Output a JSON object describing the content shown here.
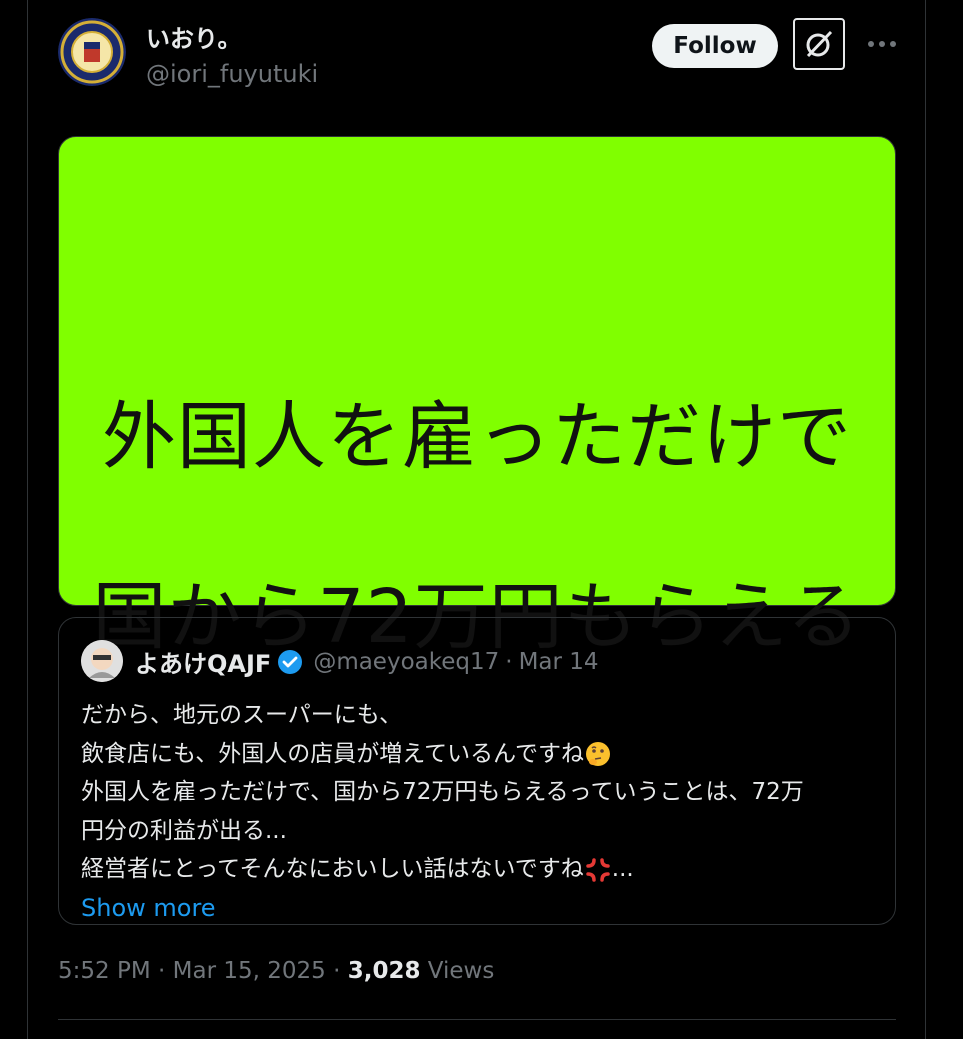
{
  "tweet": {
    "author": {
      "display_name": "いおり。",
      "handle": "@iori_fuyutuki"
    },
    "follow_label": "Follow",
    "image_text": {
      "line1": "外国人を雇っただけで",
      "line2": "国から72万円もらえる"
    },
    "quote": {
      "display_name": "よあけQAJF",
      "handle": "@maeyoakeq17",
      "separator": "·",
      "date": "Mar 14",
      "lines": [
        "だから、地元のスーパーにも、",
        "飲食店にも、外国人の店員が増えているんですね",
        "外国人を雇っただけで、国から72万円もらえるっていうことは、72万",
        "円分の利益が出る...",
        "経営者にとってそんなにおいしい話はないですね"
      ],
      "trailing_ellipsis": "...",
      "show_more": "Show more"
    },
    "meta": {
      "time": "5:52 PM",
      "sep1": "·",
      "date": "Mar 15, 2025",
      "sep2": "·",
      "views_count": "3,028",
      "views_label": "Views"
    }
  },
  "colors": {
    "accent": "#1d9bf0",
    "image_bg": "#80ff00",
    "border": "#2f3336",
    "muted": "#71767b"
  },
  "icons": [
    "fbi-seal-avatar",
    "grok-icon",
    "more-icon",
    "verified-badge-icon",
    "thinking-face-emoji",
    "anger-symbol-emoji"
  ]
}
